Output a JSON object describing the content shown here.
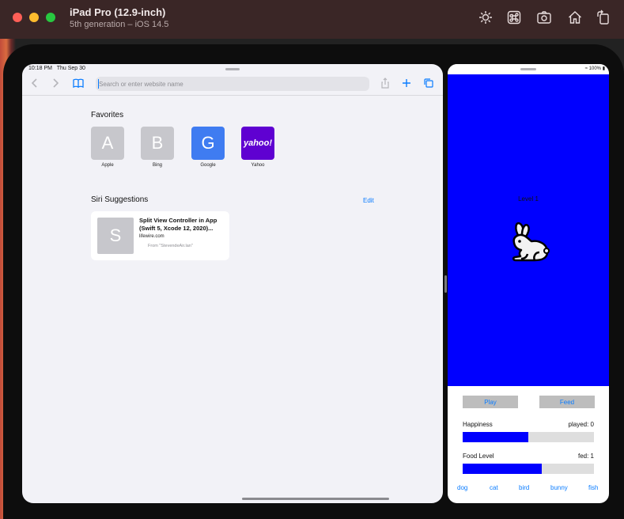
{
  "simulator": {
    "title": "iPad Pro (12.9-inch)",
    "subtitle": "5th generation – iOS 14.5",
    "toolbar_icons": [
      "brightness-icon",
      "command-icon",
      "screenshot-icon",
      "home-icon",
      "rotate-icon"
    ]
  },
  "safari": {
    "status_time": "10:18 PM",
    "status_date": "Thu Sep 30",
    "search_placeholder": "Search or enter website name",
    "favorites_title": "Favorites",
    "favorites": [
      {
        "letter": "A",
        "label": "Apple"
      },
      {
        "letter": "B",
        "label": "Bing"
      },
      {
        "letter": "G",
        "label": "Google"
      },
      {
        "letter": "yahoo!",
        "label": "Yahoo"
      }
    ],
    "siri_title": "Siri Suggestions",
    "edit_label": "Edit",
    "suggestion": {
      "letter": "S",
      "title": "Split View Controller in App (Swift 5, Xcode 12, 2020)...",
      "domain": "lifewire.com",
      "from": "From \"StevendeAir.lan\""
    }
  },
  "app": {
    "battery": "100%",
    "level_label": "Level 1",
    "play_label": "Play",
    "feed_label": "Feed",
    "happiness_label": "Happiness",
    "played_label": "played: 0",
    "happiness_level": 0.5,
    "food_label": "Food Level",
    "fed_label": "fed: 1",
    "food_level": 0.6,
    "tabs": [
      "dog",
      "cat",
      "bird",
      "bunny",
      "fish"
    ],
    "colors": {
      "background": "#0000ff",
      "bar_fill": "#0000ff",
      "button": "#bdbdbd",
      "link": "#0a7cff"
    }
  }
}
